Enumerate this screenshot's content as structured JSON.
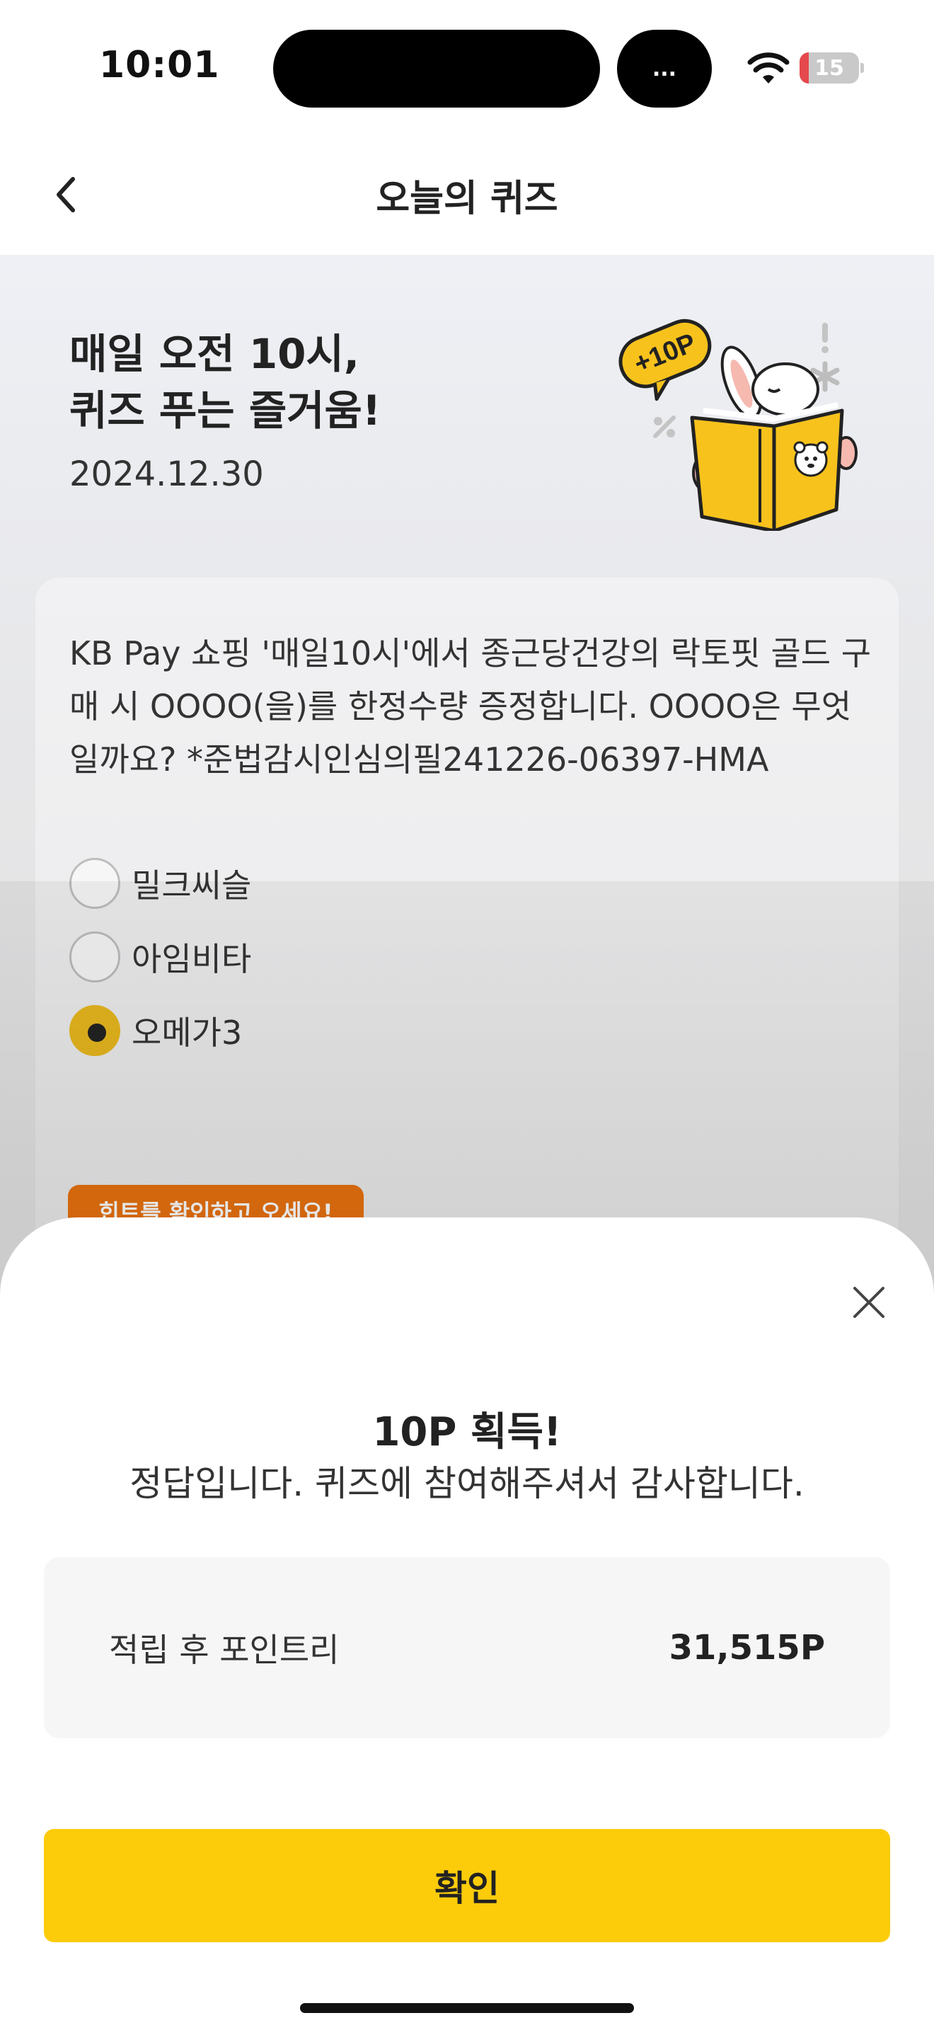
{
  "status_bar": {
    "time": "10:01",
    "island_pill_label": "...",
    "wifi_icon": "wifi-icon",
    "battery_level": "15",
    "battery_percent": 15,
    "battery_color": "#e5484d"
  },
  "nav": {
    "back_icon": "chevron-left-icon",
    "title": "오늘의 퀴즈"
  },
  "hero": {
    "heading_line1": "매일 오전 10시,",
    "heading_line2": "퀴즈 푸는 즐거움!",
    "date": "2024.12.30",
    "badge_text": "+10P",
    "mascot_icon": "rabbit-reading-book-illustration"
  },
  "quiz": {
    "question": "KB Pay 쇼핑 '매일10시'에서 종근당건강의 락토핏 골드 구매 시 OOOO(을)를 한정수량 증정합니다. OOOO은 무엇일까요? *준법감시인심의필241226-06397-HMA",
    "options": [
      {
        "label": "밀크씨슬",
        "selected": false
      },
      {
        "label": "아임비타",
        "selected": false
      },
      {
        "label": "오메가3",
        "selected": true
      }
    ],
    "hint_button": "힌트를 확인하고 오세요!"
  },
  "result_sheet": {
    "close_icon": "close-icon",
    "title": "10P 획득!",
    "message": "정답입니다. 퀴즈에 참여해주셔서 감사합니다.",
    "points_label": "적립 후 포인트리",
    "points_value": "31,515P",
    "confirm_label": "확인"
  },
  "colors": {
    "accent": "#fccc0a",
    "selected_radio": "#e8b81e",
    "hint_button": "#e9720f"
  }
}
